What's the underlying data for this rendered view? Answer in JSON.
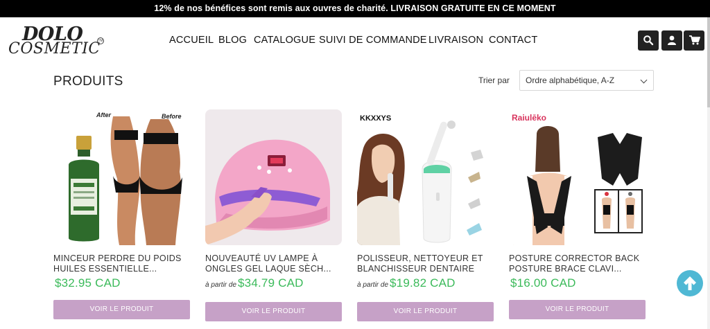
{
  "announcement": "12% de nos bénéfices sont remis aux ouvres de charité. LIVRAISON GRATUITE EN CE MOMENT",
  "logo": {
    "line1": "DOLO",
    "line2": "COSMETIC",
    "tm": "TM"
  },
  "nav": [
    "ACCUEIL",
    "BLOG",
    "CATALOGUE",
    "SUIVI DE COMMANDE",
    "LIVRAISON",
    "CONTACT"
  ],
  "header_icons": [
    "search-icon",
    "user-icon",
    "cart-icon"
  ],
  "section_title": "PRODUITS",
  "sort": {
    "label": "Trier par",
    "value": "Ordre alphabétique, A-Z"
  },
  "products": [
    {
      "title": "MINCEUR PERDRE DU POIDS HUILES ESSENTIELLE...",
      "from": "",
      "price": "$32.95 CAD",
      "button": "VOIR LE PRODUIT",
      "image_text": {
        "after": "After",
        "before": "Before"
      }
    },
    {
      "title": "NOUVEAUTÉ UV LAMPE À ONGLES GEL LAQUE SÈCH...",
      "from": "à partir de",
      "price": "$34.79 CAD",
      "button": "VOIR LE PRODUIT"
    },
    {
      "title": "POLISSEUR, NETTOYEUR ET BLANCHISSEUR DENTAIRE",
      "from": "à partir de",
      "price": "$19.82 CAD",
      "button": "VOIR LE PRODUIT",
      "image_text": {
        "brand": "KKXXYS"
      }
    },
    {
      "title": "POSTURE CORRECTOR BACK POSTURE BRACE CLAVI...",
      "from": "",
      "price": "$16.00 CAD",
      "button": "VOIR LE PRODUIT",
      "image_text": {
        "brand": "Raiulēko"
      }
    }
  ],
  "colors": {
    "price": "#3bba5a",
    "button": "#c6a1c7",
    "topbar": "#000000",
    "scroll_top": "#4fb8d4"
  }
}
